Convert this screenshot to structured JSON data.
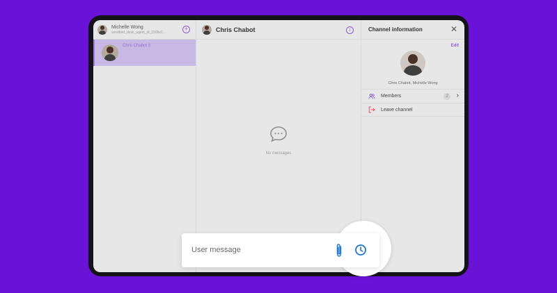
{
  "left_panel": {
    "user_name": "Michelle Wong",
    "user_sub": "sendbird_desk_agent_id_1506c0...",
    "channels": [
      {
        "name": "Chris Chabot 3"
      }
    ]
  },
  "chat": {
    "title": "Chris Chabot",
    "empty_text": "No messages"
  },
  "channel_info": {
    "title": "Channel information",
    "edit_label": "Edit",
    "member_names": "Chris Chabot, Michelle Wong",
    "members_label": "Members",
    "members_count": "2",
    "leave_label": "Leave channel"
  },
  "input": {
    "placeholder": "User message"
  },
  "colors": {
    "background": "#6a12d8",
    "accent_purple": "#8a5ad8",
    "leave_red": "#e8475f",
    "clock_blue": "#1976d2",
    "selected_channel": "#c8b9e4"
  },
  "icons": [
    "new-chat-icon",
    "info-icon",
    "close-icon",
    "chat-bubble-icon",
    "members-icon",
    "leave-icon",
    "chevron-right-icon",
    "paperclip-icon",
    "clock-icon"
  ]
}
